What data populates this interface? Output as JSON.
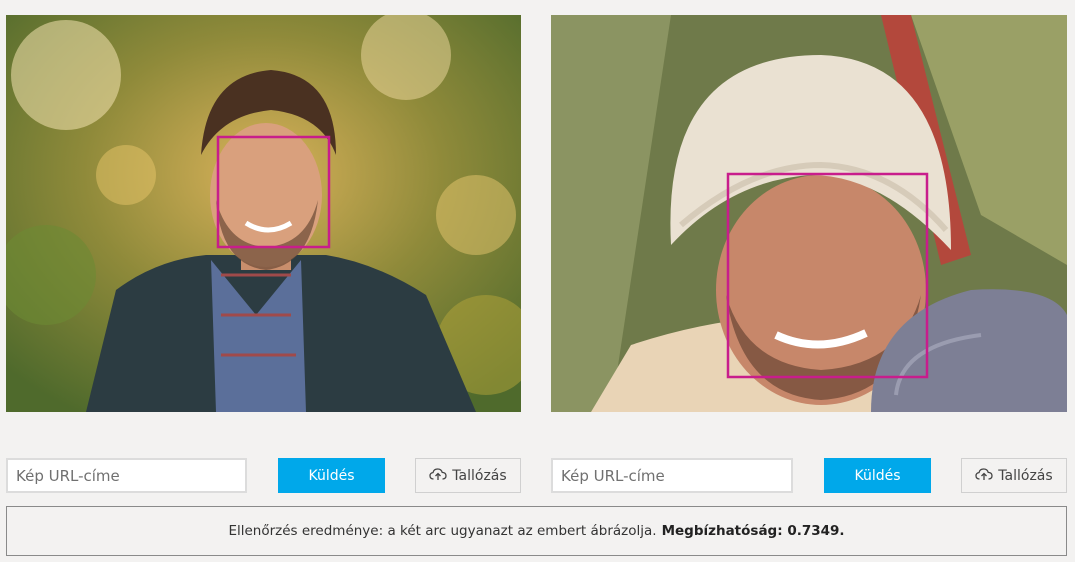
{
  "left_panel": {
    "url_placeholder": "Kép URL-címe",
    "submit_label": "Küldés",
    "browse_label": "Tallózás"
  },
  "right_panel": {
    "url_placeholder": "Kép URL-címe",
    "submit_label": "Küldés",
    "browse_label": "Tallózás"
  },
  "result": {
    "text": "Ellenőrzés eredménye: a két arc ugyanazt az embert ábrázolja.",
    "confidence_label": "Megbízhatóság: 0.7349."
  },
  "colors": {
    "accent": "#00a8ea",
    "face_box": "#c81d8c"
  },
  "icons": {
    "browse": "cloud-upload-icon"
  }
}
